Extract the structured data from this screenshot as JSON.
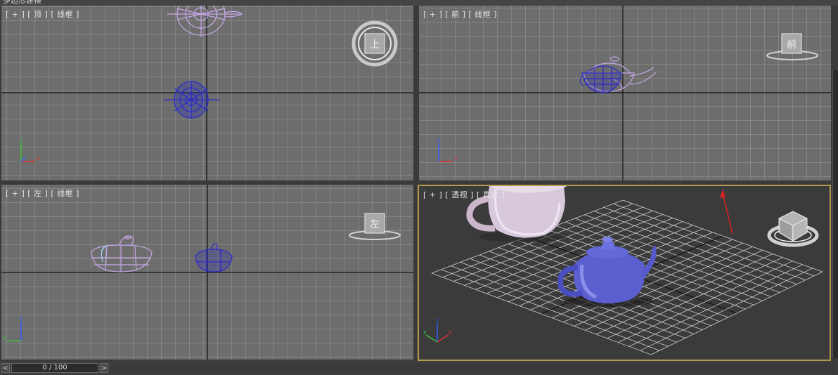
{
  "window": {
    "title": "多边形建模"
  },
  "viewports": [
    {
      "id": "top",
      "label": "[ + ] [ 顶 ] [ 线框 ]",
      "nav_text": "上"
    },
    {
      "id": "front",
      "label": "[ + ] [ 前 ] [ 线框 ]",
      "nav_text": "前"
    },
    {
      "id": "left",
      "label": "[ + ] [ 左 ] [ 线框 ]",
      "nav_text": "左"
    },
    {
      "id": "perspective",
      "label": "[ + ] [ 透视 ] [ 真实 ]",
      "nav_text": ""
    }
  ],
  "axis_labels": {
    "x": "x",
    "y": "y",
    "z": "z"
  },
  "timeline": {
    "frame": "0 / 100",
    "prev": "<",
    "next": ">"
  },
  "colors": {
    "active_border": "#b59a4e",
    "grid_bg": "#6d6d6d",
    "teapot_blue": "#3b3bd0",
    "teapot_lilac": "#c8a8e8",
    "annotation_arrow": "#e02020"
  }
}
